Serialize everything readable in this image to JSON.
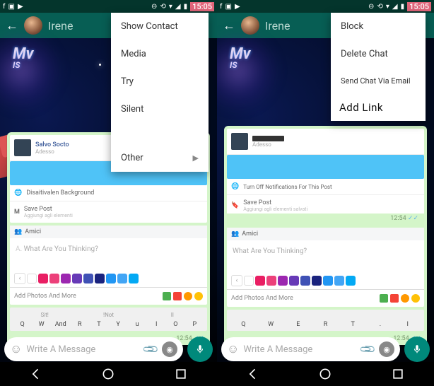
{
  "status": {
    "time": "15:05"
  },
  "header": {
    "contact_name": "Irene"
  },
  "menu_left": {
    "items": [
      "Show Contact",
      "Media",
      "Try",
      "Silent",
      "",
      "Other"
    ]
  },
  "menu_right": {
    "items": [
      "Block",
      "Delete Chat",
      "Send Chat Via Email",
      "Add Link"
    ]
  },
  "fb": {
    "post_author": "Salvo Socto",
    "post_time": "Adesso",
    "notif_left": "Disaitivalen Background",
    "notif_right": "Turn Off Notifications For This Post",
    "save_left": "Save Post",
    "save_left_sub": "Aggiungi agli elementi",
    "save_right": "Save Post",
    "save_right_sub": "Aggiungi agli elementi salvati",
    "m_label": "M",
    "amici": "Amici",
    "compose_ph": "What Are You Thinking?",
    "add_photos": "Add Photos And More"
  },
  "kbd": {
    "top_left": [
      "Sit!",
      "!Not",
      "Il"
    ],
    "row_left": [
      "Q",
      "W",
      "And",
      "R",
      "T",
      "Y",
      "u",
      "I",
      "O",
      "P"
    ],
    "row_right": [
      "Q",
      "W",
      "E",
      "R",
      "T",
      ".",
      "I"
    ]
  },
  "bubble_time": "12:54",
  "input": {
    "placeholder": "Write A Message"
  },
  "palette": [
    "#fff",
    "#e91e63",
    "#e91e63",
    "#9c27b0",
    "#673ab7",
    "#3f51b5",
    "#1a237e",
    "#2196f3",
    "#2196f3",
    "#03a9f4"
  ]
}
